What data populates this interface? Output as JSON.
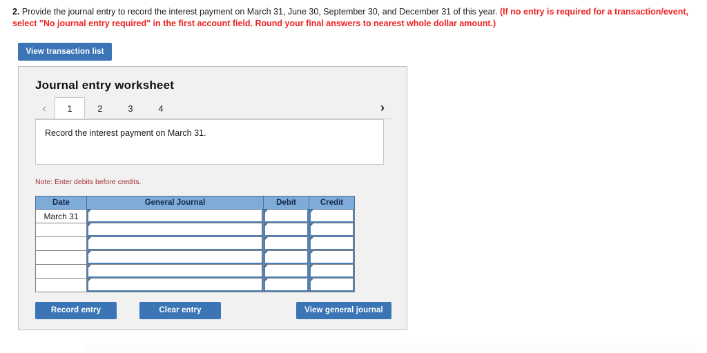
{
  "question": {
    "number": "2.",
    "text": "Provide the journal entry to record the interest payment on March 31, June 30, September 30, and December 31 of this year.",
    "emphasis": "(If no entry is required for a transaction/event, select \"No journal entry required\" in the first account field. Round your final answers to nearest whole dollar amount.)"
  },
  "toolbar": {
    "view_transaction_list_label": "View transaction list"
  },
  "worksheet": {
    "title": "Journal entry worksheet",
    "prev_arrow": "‹",
    "next_arrow": "›",
    "tabs": [
      {
        "label": "1",
        "active": true
      },
      {
        "label": "2",
        "active": false
      },
      {
        "label": "3",
        "active": false
      },
      {
        "label": "4",
        "active": false
      }
    ],
    "instruction": "Record the interest payment on March 31.",
    "note": "Note: Enter debits before credits."
  },
  "table": {
    "headers": [
      "Date",
      "General Journal",
      "Debit",
      "Credit"
    ],
    "rows": [
      {
        "date": "March 31",
        "journal": "",
        "debit": "",
        "credit": ""
      },
      {
        "date": "",
        "journal": "",
        "debit": "",
        "credit": ""
      },
      {
        "date": "",
        "journal": "",
        "debit": "",
        "credit": ""
      },
      {
        "date": "",
        "journal": "",
        "debit": "",
        "credit": ""
      },
      {
        "date": "",
        "journal": "",
        "debit": "",
        "credit": ""
      },
      {
        "date": "",
        "journal": "",
        "debit": "",
        "credit": ""
      }
    ]
  },
  "actions": {
    "record_entry_label": "Record entry",
    "clear_entry_label": "Clear entry",
    "view_general_journal_label": "View general journal"
  },
  "colors": {
    "accent_blue": "#3b75b5",
    "header_blue": "#7fabd8",
    "field_blue": "#4e7fb5",
    "emphasis_red": "#ee2222",
    "note_red": "#a33131",
    "panel_bg": "#f1f1f1"
  }
}
